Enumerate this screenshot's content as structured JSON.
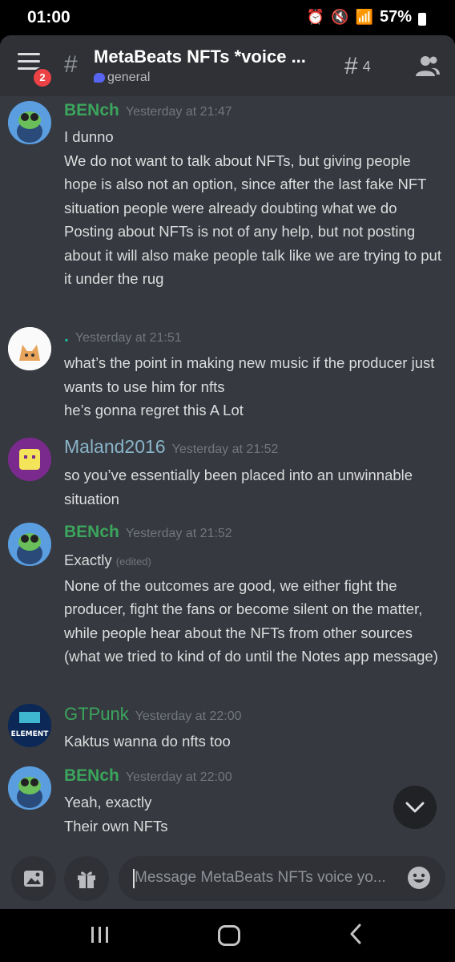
{
  "status_bar": {
    "time": "01:00",
    "battery": "57%"
  },
  "header": {
    "title": "MetaBeats NFTs *voice ...",
    "channel": "general",
    "notification_count": "2",
    "thread_count": "4"
  },
  "messages": [
    {
      "author": "BENch",
      "author_color": "#3ba55d",
      "timestamp": "Yesterday at 21:47",
      "lines": [
        "I dunno",
        "We do not want to talk about NFTs, but giving people hope is also not an option, since after the last fake NFT situation people were already doubting what we do",
        "Posting about NFTs is not of any help, but not posting about it will also make people talk like we are trying to put it under the rug"
      ]
    },
    {
      "author": ".",
      "author_color": "#1abc9c",
      "timestamp": "Yesterday at 21:51",
      "lines": [
        "what’s the point in making new music if the producer just wants to use him for nfts",
        "he’s gonna regret this A Lot"
      ]
    },
    {
      "author": "Maland2016",
      "author_color": "#8ab4c9",
      "timestamp": "Yesterday at 21:52",
      "lines": [
        "so you’ve essentially been placed into an unwinnable situation"
      ]
    },
    {
      "author": "BENch",
      "author_color": "#3ba55d",
      "timestamp": "Yesterday at 21:52",
      "first_line": "Exactly",
      "edited_label": "(edited)",
      "lines": [
        "None of the outcomes are good, we either fight the producer, fight the fans or become silent on the matter, while people hear about the NFTs from other sources (what we tried to kind of do until the Notes app message)"
      ]
    },
    {
      "author": "GTPunk",
      "author_color": "#3ba55d",
      "timestamp": "Yesterday at 22:00",
      "lines": [
        "Kaktus wanna do nfts too"
      ]
    },
    {
      "author": "BENch",
      "author_color": "#3ba55d",
      "timestamp": "Yesterday at 22:00",
      "lines": [
        "Yeah, exactly",
        "Their own NFTs"
      ]
    }
  ],
  "composer": {
    "placeholder": "Message MetaBeats NFTs voice yo..."
  },
  "avatars": {
    "gtpunk_text": "ELEMENT"
  }
}
